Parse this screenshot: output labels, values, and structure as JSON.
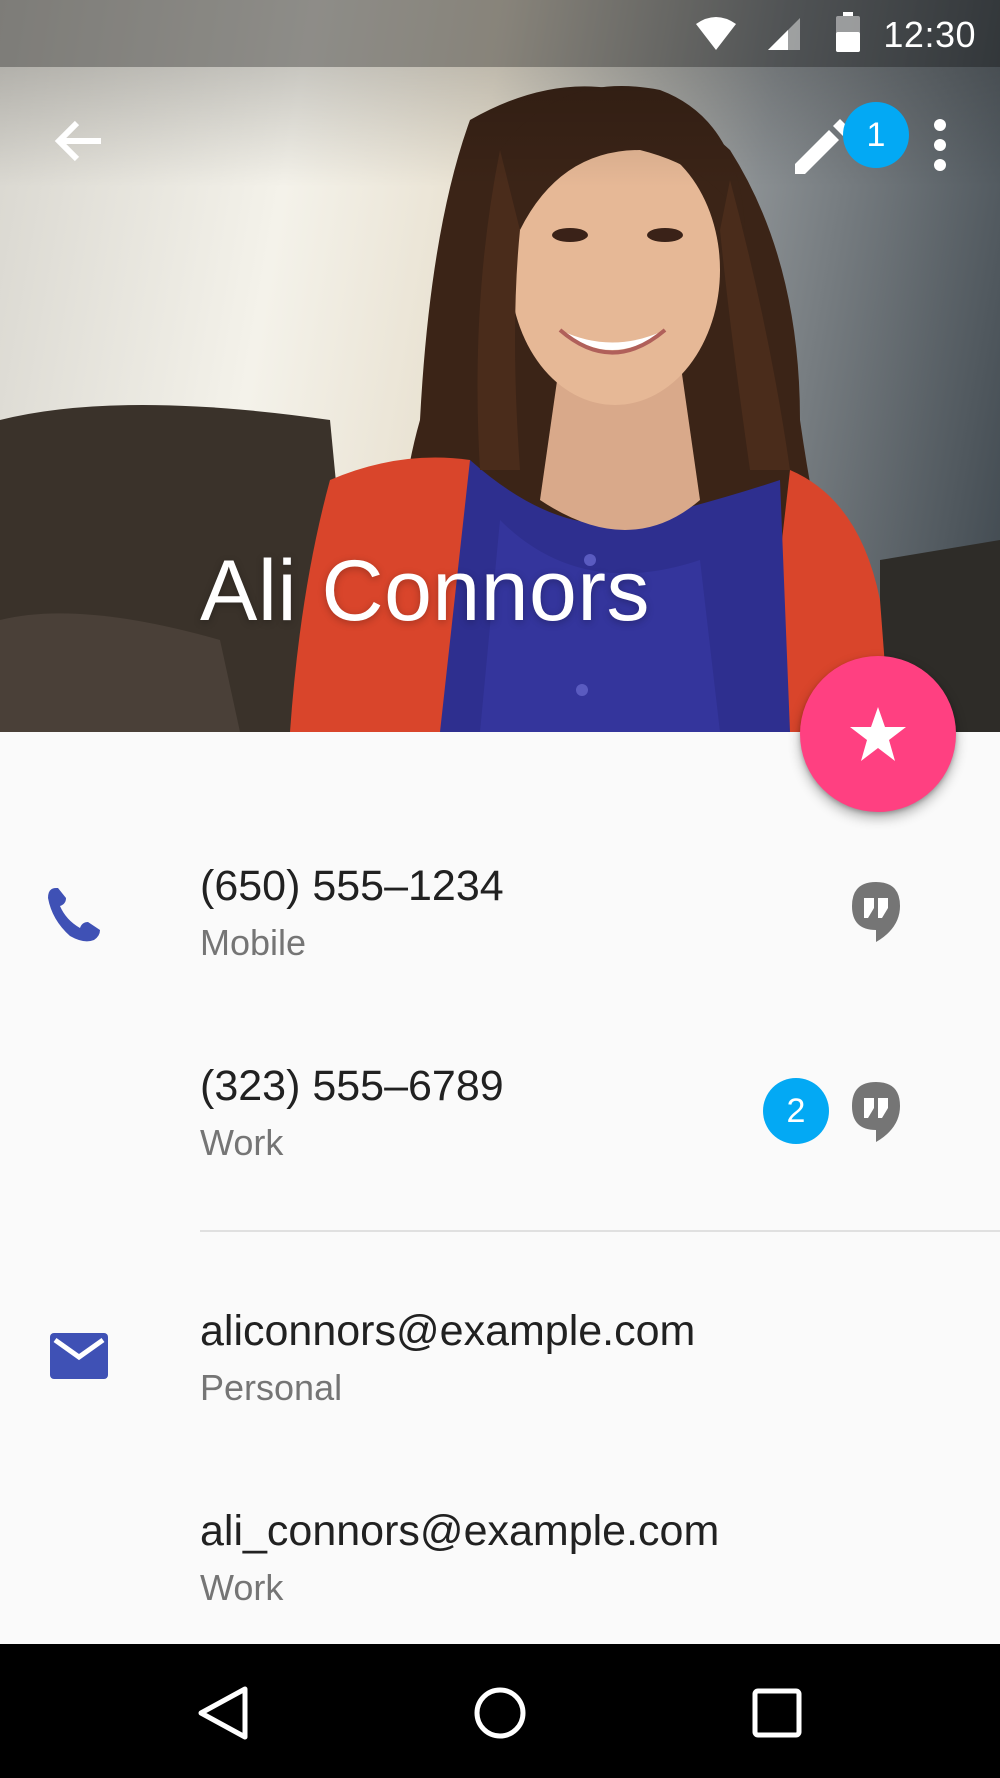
{
  "status_bar": {
    "time": "12:30",
    "icons": [
      "wifi-icon",
      "signal-icon",
      "battery-icon"
    ]
  },
  "toolbar": {
    "back_icon": "arrow-back-icon",
    "edit_icon": "pencil-icon",
    "more_icon": "more-vert-icon",
    "badge": "1"
  },
  "contact": {
    "name": "Ali Connors"
  },
  "fab": {
    "icon": "star-icon",
    "color": "#ff4081"
  },
  "phones": [
    {
      "number": "(650) 555–1234",
      "type": "Mobile"
    },
    {
      "number": "(323) 555–6789",
      "type": "Work",
      "badge": "2"
    }
  ],
  "emails": [
    {
      "address": "aliconnors@example.com",
      "type": "Personal"
    },
    {
      "address": "ali_connors@example.com",
      "type": "Work"
    }
  ],
  "colors": {
    "primary_icon": "#3f51b5",
    "badge": "#03a9f4",
    "accent": "#ff4081"
  },
  "nav": {
    "icons": [
      "back-triangle-icon",
      "home-circle-icon",
      "recents-square-icon"
    ]
  }
}
